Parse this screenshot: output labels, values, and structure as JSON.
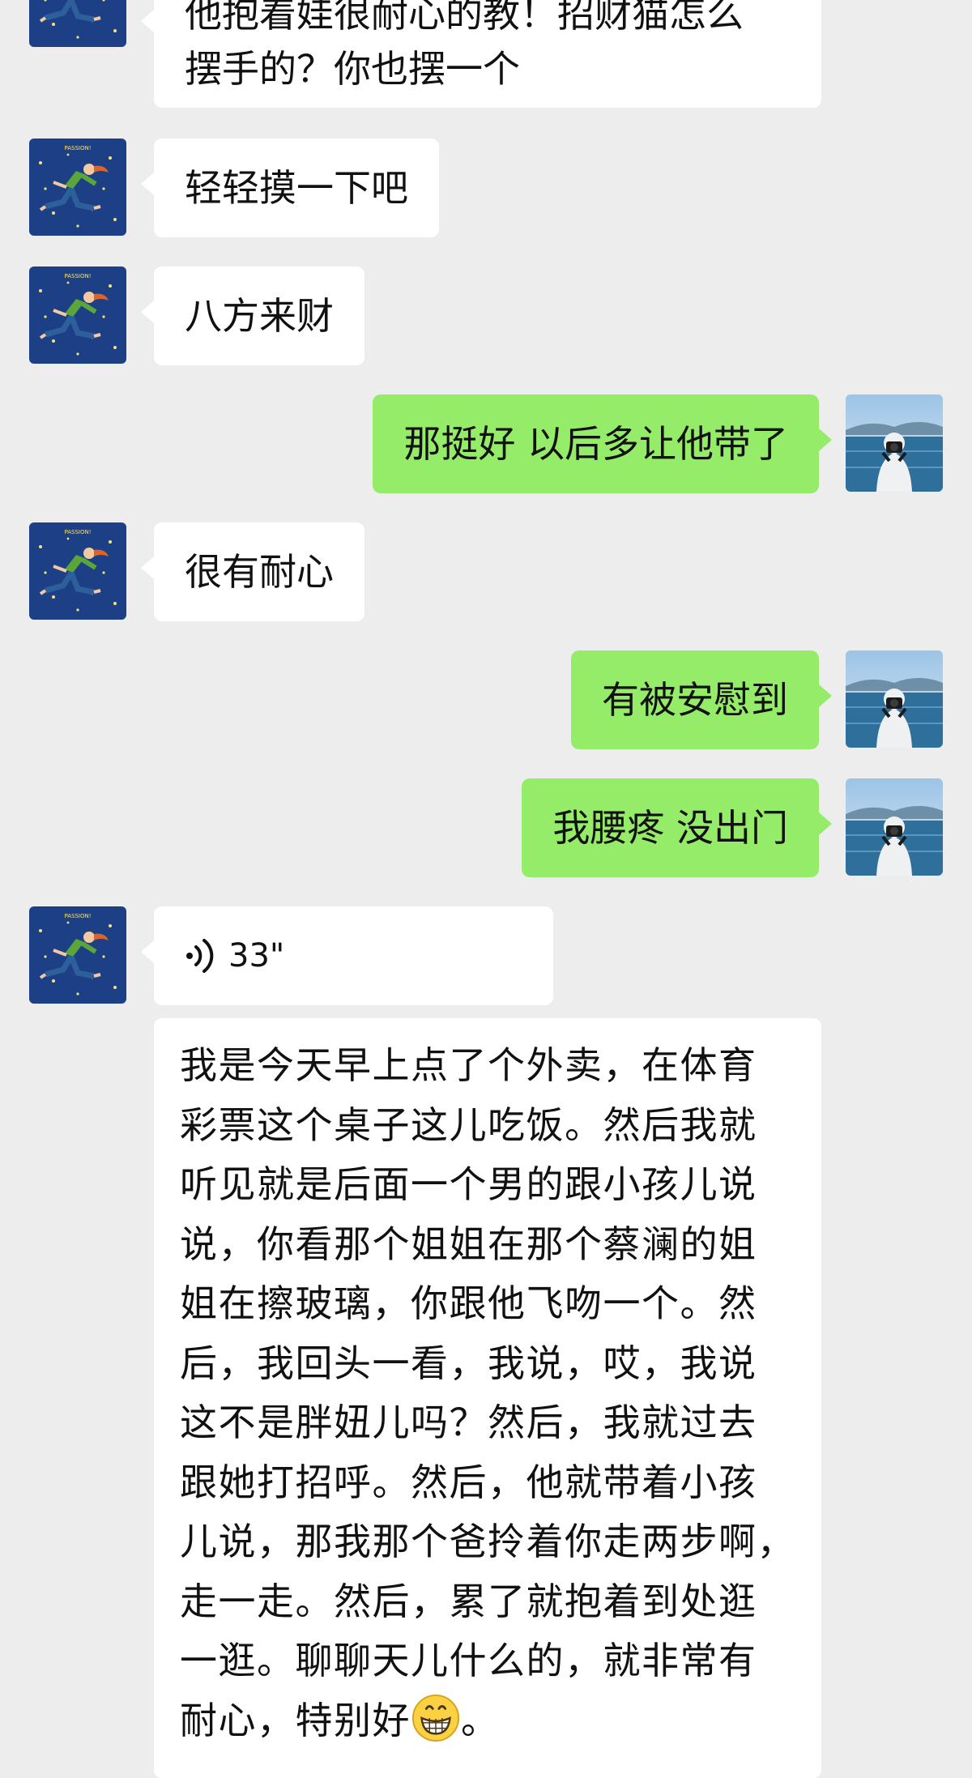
{
  "messages": {
    "m0": {
      "text_line1": "他抱着娃很耐心的教！招财猫怎么",
      "text_line2": "摆手的？你也摆一个"
    },
    "m1": {
      "text": "轻轻摸一下吧"
    },
    "m2": {
      "text": "八方来财"
    },
    "m3": {
      "text": "那挺好 以后多让他带了"
    },
    "m4": {
      "text": "很有耐心"
    },
    "m5": {
      "text": "有被安慰到"
    },
    "m6": {
      "text": "我腰疼 没出门"
    },
    "m7": {
      "duration": "33\""
    }
  },
  "transcript": {
    "lines": [
      "我是今天早上点了个外卖，在体育",
      "彩票这个桌子这儿吃饭。然后我就",
      "听见就是后面一个男的跟小孩儿说",
      "说，你看那个姐姐在那个蔡澜的姐",
      "姐在擦玻璃，你跟他飞吻一个。然",
      "后，我回头一看，我说，哎，我说",
      "这不是胖妞儿吗？然后，我就过去",
      "跟她打招呼。然后，他就带着小孩",
      "儿说，那我那个爸拎着你走两步啊，",
      "走一走。然后，累了就抱着到处逛",
      "一逛。聊聊天儿什么的，就非常有",
      "耐心，特别好"
    ],
    "ending": "。",
    "emoji": "grinning-face-emoji"
  },
  "avatars": {
    "contact": {
      "badge_text": "PASSION!",
      "icon": "running-girl-stars-avatar"
    },
    "self": {
      "icon": "photographer-by-lake-avatar"
    }
  },
  "colors": {
    "background": "#ededed",
    "incoming_bubble": "#ffffff",
    "outgoing_bubble": "#95ec69"
  }
}
